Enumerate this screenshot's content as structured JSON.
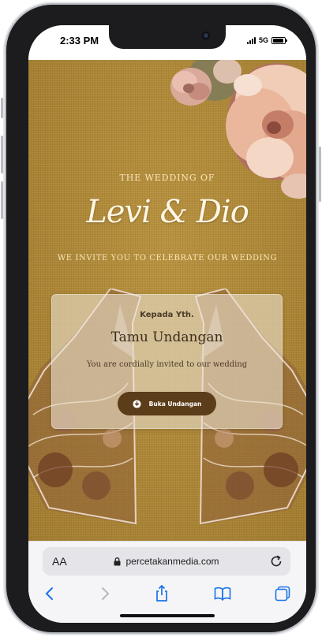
{
  "status_bar": {
    "time": "2:33 PM",
    "network": "5G"
  },
  "invitation": {
    "heading": "THE WEDDING OF",
    "couple_names": "Levi & Dio",
    "invite_line": "WE INVITE YOU TO CELEBRATE OUR WEDDING",
    "card": {
      "addressee_prefix": "Kepada Yth.",
      "guest_name": "Tamu Undangan",
      "message": "You are cordially invited to our wedding",
      "open_button_label": "Buka Undangan"
    },
    "colors": {
      "background": "#b08a3b",
      "button": "#5c3d1a",
      "gold_text": "#fbe6b8"
    }
  },
  "browser": {
    "text_size_label": "AA",
    "url": "percetakanmedia.com"
  }
}
